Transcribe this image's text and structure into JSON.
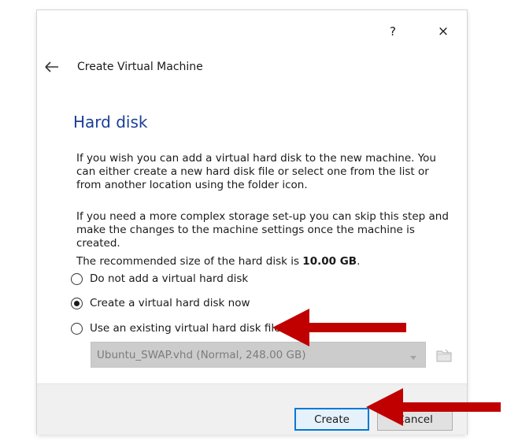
{
  "dialog": {
    "help_label": "?",
    "close_label": "×",
    "header_title": "Create Virtual Machine",
    "page_title": "Hard disk",
    "paragraph1": "If you wish you can add a virtual hard disk to the new machine. You can either create a new hard disk file or select one from the list or from another location using the folder icon.",
    "paragraph2": "If you need a more complex storage set-up you can skip this step and make the changes to the machine settings once the machine is created.",
    "recommend_prefix": "The recommended size of the hard disk is ",
    "recommend_size": "10.00 GB",
    "recommend_suffix": ".",
    "options": [
      {
        "label": "Do not add a virtual hard disk",
        "selected": false
      },
      {
        "label": "Create a virtual hard disk now",
        "selected": true
      },
      {
        "label": "Use an existing virtual hard disk file",
        "selected": false
      }
    ],
    "disk_select_value": "Ubuntu_SWAP.vhd (Normal, 248.00 GB)",
    "buttons": {
      "create": "Create",
      "cancel": "Cancel"
    }
  },
  "icons": {
    "back": "back-arrow-icon",
    "folder": "folder-icon",
    "dropdown": "chevron-down-icon"
  },
  "colors": {
    "page_title": "#1a3e9a",
    "annotation_arrow": "#c00000",
    "create_button_border": "#0078d7",
    "footer": "#f0f0f0",
    "disabled_combo": "#cccccc"
  }
}
